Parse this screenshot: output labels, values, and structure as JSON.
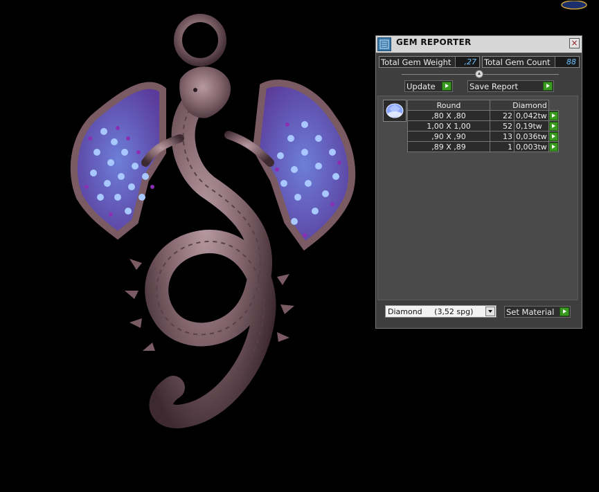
{
  "panel": {
    "title": "GEM REPORTER",
    "close_label": "×",
    "total_weight_label": "Total Gem Weight",
    "total_weight_value": ",27",
    "total_count_label": "Total Gem Count",
    "total_count_value": "88",
    "update_label": "Update",
    "save_report_label": "Save Report",
    "set_material_label": "Set Material",
    "material_selected": "Diamond     (3,52 spg)"
  },
  "table": {
    "shape_header": "Round",
    "material_header": "Diamond",
    "rows": [
      {
        "size": ",80 X ,80",
        "count": "22",
        "weight": "0,042tw"
      },
      {
        "size": "1,00 X 1,00",
        "count": "52",
        "weight": "0,19tw"
      },
      {
        "size": ",90 X ,90",
        "count": "13",
        "weight": "0,036tw"
      },
      {
        "size": ",89 X ,89",
        "count": "1",
        "weight": "0,003tw"
      }
    ]
  },
  "colors": {
    "metal": "#8a6b74",
    "gem_blue": "#8fb8ff",
    "gem_purple": "#8a2fb3",
    "accent_green": "#3a9a1f",
    "value_blue": "#6bc4ff"
  },
  "icons": [
    "gem-reporter-icon",
    "close-icon",
    "round-gem-icon",
    "play-arrow-icon",
    "dropdown-arrow-icon",
    "app-logo-icon"
  ]
}
